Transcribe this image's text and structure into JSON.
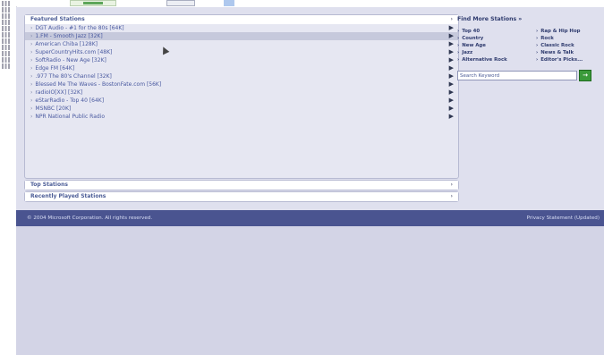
{
  "featured": {
    "title": "Featured Stations",
    "stations": [
      {
        "label": "DGT Audio - #1 for the 80s [64K]"
      },
      {
        "label": "1.FM - Smooth Jazz [32K]",
        "selected": true
      },
      {
        "label": "American Chiba [128K]"
      },
      {
        "label": "SuperCountryHits.com [48K]"
      },
      {
        "label": "SoftRadio - New Age [32K]"
      },
      {
        "label": "Edge FM [64K]"
      },
      {
        "label": ".977 The 80's Channel [32K]"
      },
      {
        "label": "Blessed Me The Waves - BostonFate.com [56K]"
      },
      {
        "label": "radioIO[XX] [32K]"
      },
      {
        "label": "eStarRadio - Top 40 [64K]"
      },
      {
        "label": "MSNBC [20K]"
      },
      {
        "label": "NPR National Public Radio"
      }
    ]
  },
  "sections": {
    "top_label": "Top Stations",
    "recent_label": "Recently Played Stations"
  },
  "sidebar": {
    "title": "Find More Stations »",
    "genres_left": [
      "Top 40",
      "Country",
      "New Age",
      "Jazz",
      "Alternative Rock"
    ],
    "genres_right": [
      "Rap & Hip Hop",
      "Rock",
      "Classic Rock",
      "News & Talk",
      "Editor's Picks..."
    ],
    "search_value": "Search Keyword",
    "go_label": "→"
  },
  "footer": {
    "copyright": "© 2004 Microsoft Corporation. All rights reserved.",
    "privacy": "Privacy Statement (Updated)"
  },
  "icons": {
    "play": "▶",
    "bullet": "›",
    "chevron": "›"
  },
  "colors": {
    "footer_bg": "#4a5490",
    "panel_border": "#b7bad2",
    "go_button": "#3a9a3a",
    "page_bg": "#dfe0ee"
  }
}
